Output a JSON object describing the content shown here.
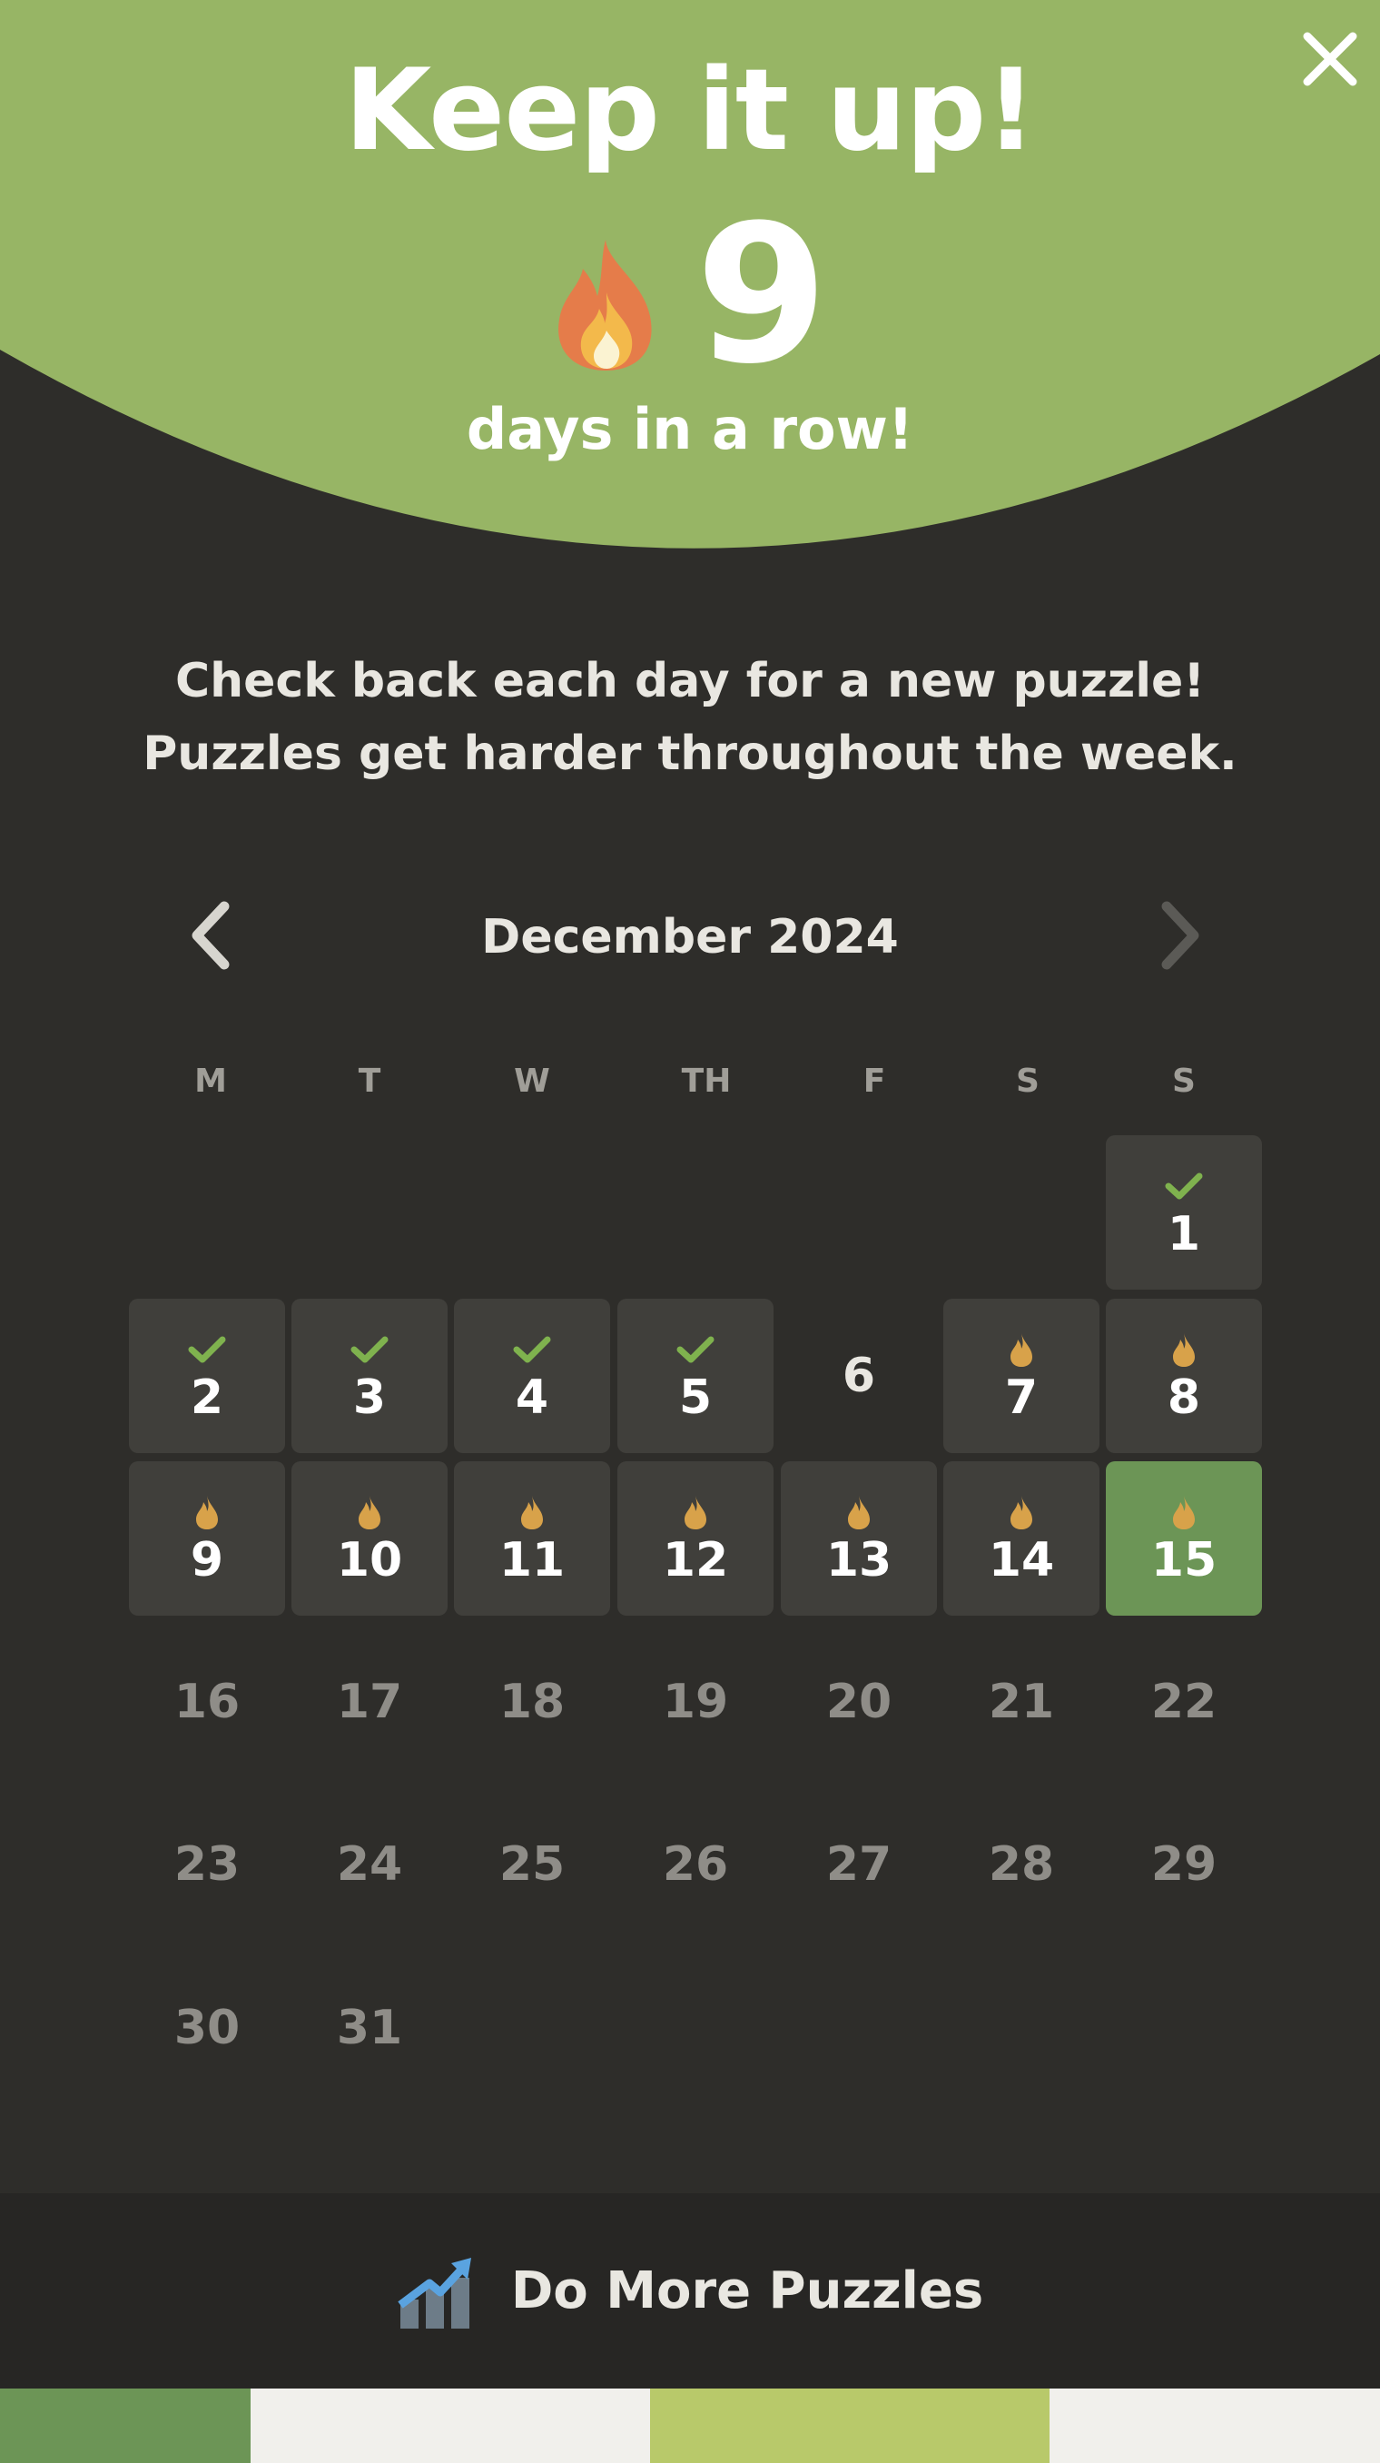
{
  "header": {
    "title": "Keep it up!",
    "streak_count": "9",
    "streak_suffix": "days in a row!",
    "accent_color": "#97b565",
    "icons": {
      "close": "close-icon",
      "streak": "fire-icon"
    }
  },
  "message": {
    "line1": "Check back each day for a new puzzle!",
    "line2": "Puzzles get harder throughout the week."
  },
  "calendar": {
    "month_label": "December 2024",
    "weekdays": [
      "M",
      "T",
      "W",
      "TH",
      "F",
      "S",
      "S"
    ],
    "days": [
      {
        "label": "1",
        "status": "solved"
      },
      {
        "label": "2",
        "status": "solved"
      },
      {
        "label": "3",
        "status": "solved"
      },
      {
        "label": "4",
        "status": "solved"
      },
      {
        "label": "5",
        "status": "solved"
      },
      {
        "label": "6",
        "status": "none"
      },
      {
        "label": "7",
        "status": "streak"
      },
      {
        "label": "8",
        "status": "streak"
      },
      {
        "label": "9",
        "status": "streak"
      },
      {
        "label": "10",
        "status": "streak"
      },
      {
        "label": "11",
        "status": "streak"
      },
      {
        "label": "12",
        "status": "streak"
      },
      {
        "label": "13",
        "status": "streak"
      },
      {
        "label": "14",
        "status": "streak"
      },
      {
        "label": "15",
        "status": "today"
      },
      {
        "label": "16",
        "status": "future"
      },
      {
        "label": "17",
        "status": "future"
      },
      {
        "label": "18",
        "status": "future"
      },
      {
        "label": "19",
        "status": "future"
      },
      {
        "label": "20",
        "status": "future"
      },
      {
        "label": "21",
        "status": "future"
      },
      {
        "label": "22",
        "status": "future"
      },
      {
        "label": "23",
        "status": "future"
      },
      {
        "label": "24",
        "status": "future"
      },
      {
        "label": "25",
        "status": "future"
      },
      {
        "label": "26",
        "status": "future"
      },
      {
        "label": "27",
        "status": "future"
      },
      {
        "label": "28",
        "status": "future"
      },
      {
        "label": "29",
        "status": "future"
      },
      {
        "label": "30",
        "status": "future"
      },
      {
        "label": "31",
        "status": "future"
      }
    ],
    "colors": {
      "solved_check": "#7fb24e",
      "streak_flame": "#d8a24a",
      "today_bg": "#6c9556",
      "cell_bg": "#403f3b"
    }
  },
  "footer": {
    "label": "Do More Puzzles",
    "icon": "chart-up-icon"
  },
  "bottom_strip_colors": [
    "#6c9556",
    "#f1f0ec",
    "#b8c96a",
    "#f1f0ec"
  ]
}
